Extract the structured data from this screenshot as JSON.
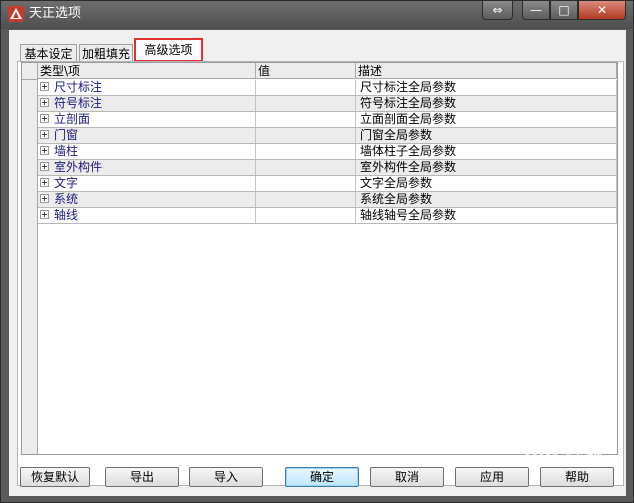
{
  "window": {
    "title": "天正选项",
    "buttons": {
      "resize": "⇔",
      "minimize": "—",
      "maximize": "□",
      "close": "✕"
    }
  },
  "tabs": [
    {
      "label": "基本设定"
    },
    {
      "label": "加粗填充"
    },
    {
      "label": "高级选项",
      "active": true
    }
  ],
  "grid": {
    "columns": [
      "类型\\项",
      "值",
      "描述"
    ],
    "rows": [
      {
        "type": "尺寸标注",
        "value": "",
        "desc": "尺寸标注全局参数"
      },
      {
        "type": "符号标注",
        "value": "",
        "desc": "符号标注全局参数"
      },
      {
        "type": "立剖面",
        "value": "",
        "desc": "立面剖面全局参数"
      },
      {
        "type": "门窗",
        "value": "",
        "desc": "门窗全局参数"
      },
      {
        "type": "墙柱",
        "value": "",
        "desc": "墙体柱子全局参数"
      },
      {
        "type": "室外构件",
        "value": "",
        "desc": "室外构件全局参数"
      },
      {
        "type": "文字",
        "value": "",
        "desc": "文字全局参数"
      },
      {
        "type": "系统",
        "value": "",
        "desc": "系统全局参数"
      },
      {
        "type": "轴线",
        "value": "",
        "desc": "轴线轴号全局参数"
      }
    ]
  },
  "footer_buttons": {
    "restore_default": "恢复默认",
    "export": "导出",
    "import": "导入",
    "ok": "确定",
    "cancel": "取消",
    "apply": "应用",
    "help": "帮助"
  },
  "watermark": "Bai 经验"
}
